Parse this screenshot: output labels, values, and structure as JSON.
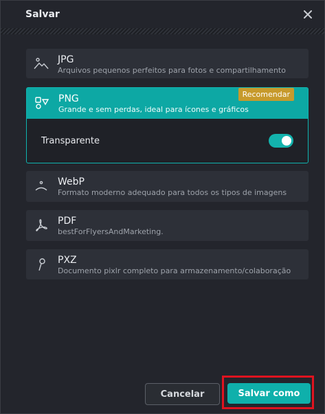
{
  "dialog": {
    "title": "Salvar",
    "close_icon": "close-icon"
  },
  "formats": [
    {
      "id": "jpg",
      "name": "JPG",
      "desc": "Arquivos pequenos perfeitos para fotos e compartilhamento",
      "icon": "landscape-icon"
    },
    {
      "id": "png",
      "name": "PNG",
      "desc": "Grande e sem perdas, ideal para ícones e gráficos",
      "icon": "shapes-icon",
      "badge": "Recomendar",
      "selected": true
    },
    {
      "id": "webp",
      "name": "WebP",
      "desc": "Formato moderno adequado para todos os tipos de imagens",
      "icon": "smile-icon"
    },
    {
      "id": "pdf",
      "name": "PDF",
      "desc": "bestForFlyersAndMarketing.",
      "icon": "pdf-icon"
    },
    {
      "id": "pxz",
      "name": "PXZ",
      "desc": "Documento pixlr completo para armazenamento/colaboração",
      "icon": "pixlr-icon"
    }
  ],
  "png_options": {
    "transparent_label": "Transparente",
    "transparent_on": true
  },
  "buttons": {
    "cancel": "Cancelar",
    "save_as": "Salvar como"
  },
  "colors": {
    "accent": "#0da8a4",
    "badge": "#c79a2c",
    "highlight": "#e0131f"
  }
}
